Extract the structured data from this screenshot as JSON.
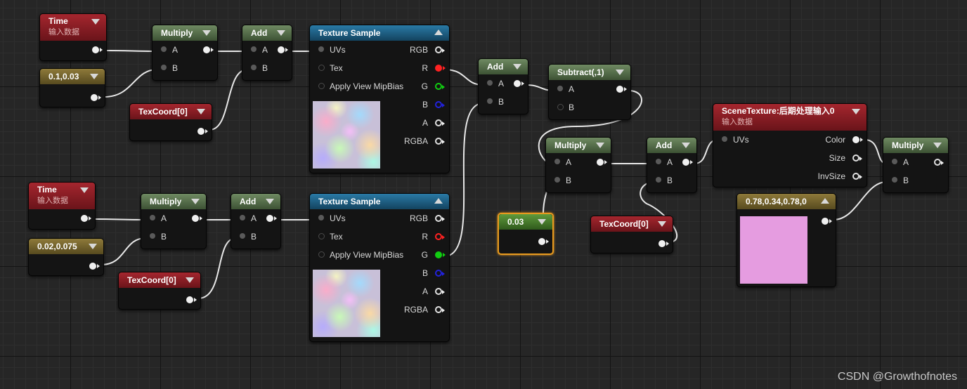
{
  "watermark": "CSDN @Growthofnotes",
  "constant_color": "#e59ce0",
  "nodes": {
    "time1": {
      "title": "Time",
      "subtitle": "输入数据"
    },
    "const1": {
      "title": "0.1,0.03"
    },
    "mul1": {
      "title": "Multiply",
      "in_a": "A",
      "in_b": "B"
    },
    "add1": {
      "title": "Add",
      "in_a": "A",
      "in_b": "B"
    },
    "tc1": {
      "title": "TexCoord[0]"
    },
    "tex1": {
      "title": "Texture Sample",
      "in_uvs": "UVs",
      "in_tex": "Tex",
      "in_mip": "Apply View MipBias",
      "out_rgb": "RGB",
      "out_r": "R",
      "out_g": "G",
      "out_b": "B",
      "out_a": "A",
      "out_rgba": "RGBA"
    },
    "time2": {
      "title": "Time",
      "subtitle": "输入数据"
    },
    "const2": {
      "title": "0.02,0.075"
    },
    "mul2": {
      "title": "Multiply",
      "in_a": "A",
      "in_b": "B"
    },
    "add2": {
      "title": "Add",
      "in_a": "A",
      "in_b": "B"
    },
    "tc2": {
      "title": "TexCoord[0]"
    },
    "tex2": {
      "title": "Texture Sample",
      "in_uvs": "UVs",
      "in_tex": "Tex",
      "in_mip": "Apply View MipBias",
      "out_rgb": "RGB",
      "out_r": "R",
      "out_g": "G",
      "out_b": "B",
      "out_a": "A",
      "out_rgba": "RGBA"
    },
    "add3": {
      "title": "Add",
      "in_a": "A",
      "in_b": "B"
    },
    "sub": {
      "title": "Subtract(,1)",
      "in_a": "A",
      "in_b": "B"
    },
    "const3": {
      "title": "0.03"
    },
    "mul3": {
      "title": "Multiply",
      "in_a": "A",
      "in_b": "B"
    },
    "add4": {
      "title": "Add",
      "in_a": "A",
      "in_b": "B"
    },
    "tc3": {
      "title": "TexCoord[0]"
    },
    "scene": {
      "title": "SceneTexture:后期处理输入0",
      "subtitle": "输入数据",
      "in_uvs": "UVs",
      "out_color": "Color",
      "out_size": "Size",
      "out_invsize": "InvSize"
    },
    "const4": {
      "title": "0.78,0.34,0.78,0"
    },
    "mul4": {
      "title": "Multiply",
      "in_a": "A",
      "in_b": "B"
    }
  }
}
